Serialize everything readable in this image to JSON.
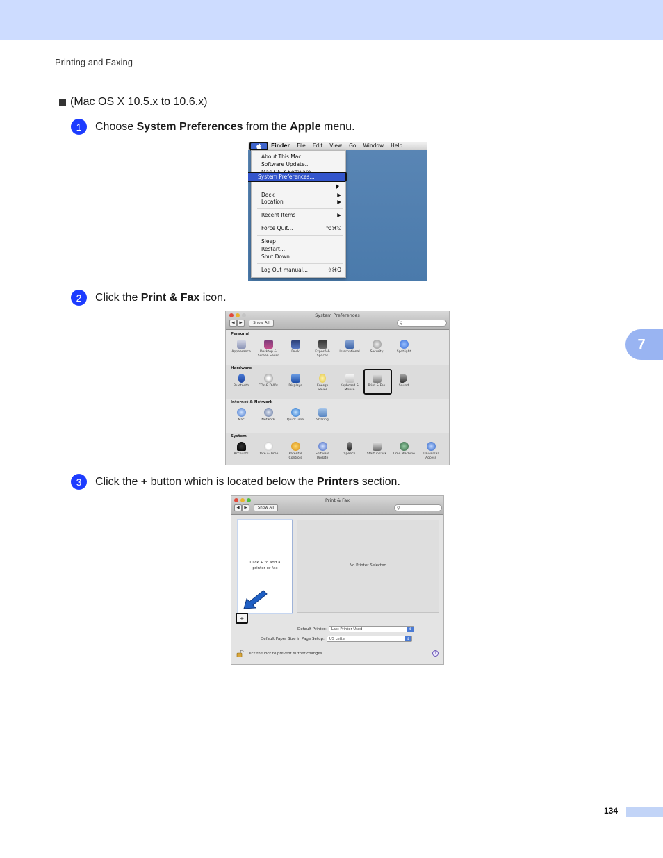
{
  "header": {
    "running_head": "Printing and Faxing",
    "chapter_tab": "7"
  },
  "intro": {
    "bullet": "(Mac OS X 10.5.x to 10.6.x)"
  },
  "steps": [
    {
      "num": "1",
      "pre": "Choose ",
      "b1": "System Preferences",
      "mid": " from the ",
      "b2": "Apple",
      "post": " menu."
    },
    {
      "num": "2",
      "pre": "Click the ",
      "b1": "Print & Fax",
      "post": " icon."
    },
    {
      "num": "3",
      "pre": "Click the ",
      "b1": "+",
      "mid": " button which is located below the ",
      "b2": "Printers",
      "post": " section."
    }
  ],
  "apple_menu": {
    "menubar": [
      "Finder",
      "File",
      "Edit",
      "View",
      "Go",
      "Window",
      "Help"
    ],
    "items": {
      "about": "About This Mac",
      "update": "Software Update...",
      "osx": "Mac OS X Software...",
      "prefs": "System Preferences...",
      "dock": "Dock",
      "location": "Location",
      "recent": "Recent Items",
      "force_quit": "Force Quit...",
      "force_quit_shortcut": "⌥⌘⎋",
      "sleep": "Sleep",
      "restart": "Restart...",
      "shutdown": "Shut Down...",
      "logout": "Log Out manual...",
      "logout_shortcut": "⇧⌘Q"
    }
  },
  "system_prefs": {
    "title": "System Preferences",
    "show_all": "Show All",
    "sections": {
      "personal": {
        "title": "Personal",
        "items": [
          "Appearance",
          "Desktop &\nScreen Saver",
          "Dock",
          "Exposé &\nSpaces",
          "International",
          "Security",
          "Spotlight"
        ]
      },
      "hardware": {
        "title": "Hardware",
        "items": [
          "Bluetooth",
          "CDs & DVDs",
          "Displays",
          "Energy\nSaver",
          "Keyboard &\nMouse",
          "Print & Fax",
          "Sound"
        ]
      },
      "internet": {
        "title": "Internet & Network",
        "items": [
          "Mac",
          "Network",
          "QuickTime",
          "Sharing"
        ]
      },
      "system": {
        "title": "System",
        "items": [
          "Accounts",
          "Date & Time",
          "Parental\nControls",
          "Software\nUpdate",
          "Speech",
          "Startup Disk",
          "Time Machine",
          "Universal\nAccess"
        ]
      }
    }
  },
  "print_fax": {
    "title": "Print & Fax",
    "show_all": "Show All",
    "list_hint": "Click + to add a printer or fax",
    "no_printer": "No Printer Selected",
    "plus": "+",
    "default_printer_label": "Default Printer:",
    "default_printer_value": "Last Printer Used",
    "paper_size_label": "Default Paper Size in Page Setup:",
    "paper_size_value": "US Letter",
    "lock_text": "Click the lock to prevent further changes.",
    "help": "?"
  },
  "footer": {
    "page_number": "134"
  },
  "colors": {
    "accent": "#1d3cff",
    "header_band": "#cddcff",
    "tab": "#99b4f2"
  }
}
